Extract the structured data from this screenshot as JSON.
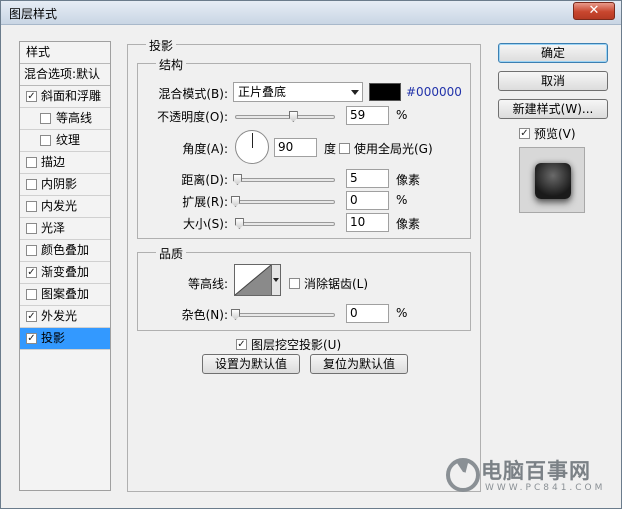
{
  "window": {
    "title": "图层样式",
    "close_glyph": "✕"
  },
  "styles": {
    "header": "样式",
    "blend_options": "混合选项:默认",
    "items": [
      {
        "label": "斜面和浮雕",
        "checked": true,
        "sub": false,
        "selected": false
      },
      {
        "label": "等高线",
        "checked": false,
        "sub": true,
        "selected": false
      },
      {
        "label": "纹理",
        "checked": false,
        "sub": true,
        "selected": false
      },
      {
        "label": "描边",
        "checked": false,
        "sub": false,
        "selected": false
      },
      {
        "label": "内阴影",
        "checked": false,
        "sub": false,
        "selected": false
      },
      {
        "label": "内发光",
        "checked": false,
        "sub": false,
        "selected": false
      },
      {
        "label": "光泽",
        "checked": false,
        "sub": false,
        "selected": false
      },
      {
        "label": "颜色叠加",
        "checked": false,
        "sub": false,
        "selected": false
      },
      {
        "label": "渐变叠加",
        "checked": true,
        "sub": false,
        "selected": false
      },
      {
        "label": "图案叠加",
        "checked": false,
        "sub": false,
        "selected": false
      },
      {
        "label": "外发光",
        "checked": true,
        "sub": false,
        "selected": false
      },
      {
        "label": "投影",
        "checked": true,
        "sub": false,
        "selected": true
      }
    ]
  },
  "drop_shadow": {
    "title": "投影",
    "structure": {
      "title": "结构",
      "blend_mode_label": "混合模式(B):",
      "blend_mode_value": "正片叠底",
      "color_hex": "#000000",
      "opacity_label": "不透明度(O):",
      "opacity_value": "59",
      "opacity_unit": "%",
      "opacity_fraction": 0.59,
      "angle_label": "角度(A):",
      "angle_value": "90",
      "angle_unit": "度",
      "global_light_label": "使用全局光(G)",
      "global_light_checked": false,
      "distance_label": "距离(D):",
      "distance_value": "5",
      "distance_unit": "像素",
      "distance_fraction": 0.02,
      "spread_label": "扩展(R):",
      "spread_value": "0",
      "spread_unit": "%",
      "spread_fraction": 0.0,
      "size_label": "大小(S):",
      "size_value": "10",
      "size_unit": "像素",
      "size_fraction": 0.04
    },
    "quality": {
      "title": "品质",
      "contour_label": "等高线:",
      "antialias_label": "消除锯齿(L)",
      "antialias_checked": false,
      "noise_label": "杂色(N):",
      "noise_value": "0",
      "noise_unit": "%",
      "noise_fraction": 0.0
    },
    "knockout_label": "图层挖空投影(U)",
    "knockout_checked": true,
    "make_default_label": "设置为默认值",
    "reset_default_label": "复位为默认值"
  },
  "buttons": {
    "ok": "确定",
    "cancel": "取消",
    "new_style": "新建样式(W)...",
    "preview_label": "预览(V)",
    "preview_checked": true
  },
  "watermark": {
    "text": "电脑百事网",
    "sub": "WWW.PC841.COM"
  },
  "check_glyph": "✓"
}
